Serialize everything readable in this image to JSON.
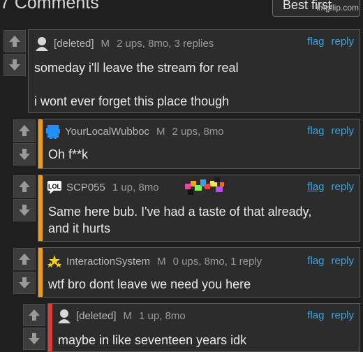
{
  "header": {
    "title": "7 Comments",
    "sort_label": "Best first",
    "watermark": "imgflip.com"
  },
  "comments": [
    {
      "user": "[deleted]",
      "mod": "M",
      "stats": "2 ups, 8mo, 3 replies",
      "flag": "flag",
      "reply": "reply",
      "lines": [
        "someday i'll leave the stream for real",
        "i wont ever forget this place though"
      ],
      "avatar": "default-avatar-icon"
    },
    {
      "user": "YourLocalWubboc",
      "mod": "M",
      "stats": "2 ups, 8mo",
      "flag": "flag",
      "reply": "reply",
      "lines": [
        "Oh f**k"
      ],
      "avatar": "blue-pixel-avatar-icon"
    },
    {
      "user": "SCP055",
      "mod": "",
      "stats": "1 up, 8mo",
      "flag": "flag",
      "reply": "reply",
      "lines": [
        "Same here bub. I've had a taste of that already,",
        "and it hurts"
      ],
      "avatar": "lol-avatar-icon"
    },
    {
      "user": "InteractionSystem",
      "mod": "M",
      "stats": "0 ups, 8mo, 1 reply",
      "flag": "flag",
      "reply": "reply",
      "lines": [
        "wtf bro dont leave we need you here"
      ],
      "avatar": "stars-avatar-icon"
    },
    {
      "user": "[deleted]",
      "mod": "M",
      "stats": "1 up, 8mo",
      "flag": "flag",
      "reply": "reply",
      "lines": [
        "maybe in like seventeen years idk"
      ],
      "avatar": "default-avatar-icon"
    }
  ],
  "colors": {
    "orange_bar": "#f39c12",
    "red_bar": "#e53935",
    "link": "#3aa5e0"
  }
}
